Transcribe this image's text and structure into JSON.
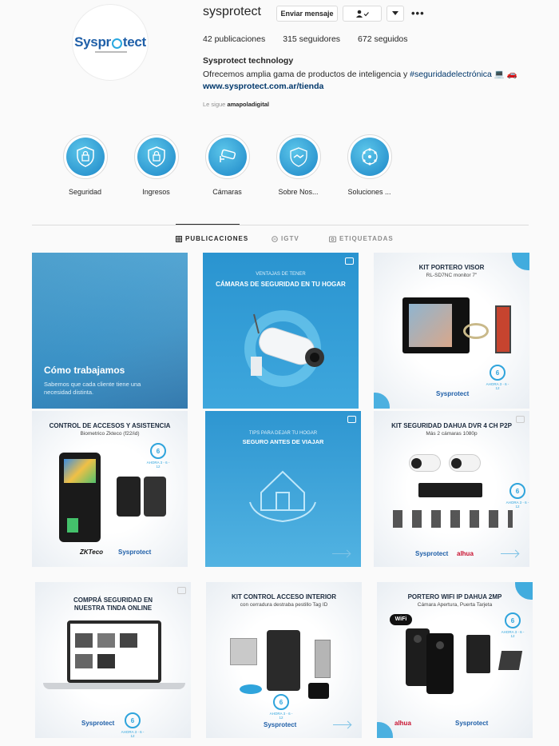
{
  "profile": {
    "username": "sysprotect",
    "avatar_logo": "Sysprotect",
    "message_button": "Enviar mensaje",
    "follow_icon": "person-check-icon",
    "dropdown_icon": "chevron-down-icon",
    "more_icon": "more-dots-icon",
    "more_label": "•••",
    "stats": {
      "posts": "42 publicaciones",
      "followers": "315 seguidores",
      "following": "672 seguidos"
    },
    "bio": {
      "name": "Sysprotect technology",
      "text": "Ofrecemos amplia gama de productos de inteligencia y ",
      "hashtag": "#seguridadelectrónica",
      "emoji": " 💻 🚗",
      "link": "www.sysprotect.com.ar/tienda"
    },
    "followed_by_prefix": "Le sigue ",
    "followed_by_user": "amapoladigital"
  },
  "highlights": [
    {
      "label": "Seguridad",
      "icon": "shield-lock-icon"
    },
    {
      "label": "Ingresos",
      "icon": "shield-lock-icon"
    },
    {
      "label": "Cámaras",
      "icon": "security-camera-icon"
    },
    {
      "label": "Sobre Nos...",
      "icon": "handshake-icon"
    },
    {
      "label": "Soluciones ...",
      "icon": "network-globe-icon"
    }
  ],
  "tabs": [
    {
      "label": "PUBLICACIONES",
      "icon": "grid-icon",
      "active": true
    },
    {
      "label": "IGTV",
      "icon": "igtv-icon",
      "active": false
    },
    {
      "label": "ETIQUETADAS",
      "icon": "tagged-icon",
      "active": false
    }
  ],
  "posts": [
    {
      "title": "Cómo trabajamos",
      "sub": "Sabemos que cada cliente tiene una necesidad distinta."
    },
    {
      "pre": "VENTAJAS DE TENER",
      "title": "CÁMARAS DE SEGURIDAD EN TU HOGAR"
    },
    {
      "title": "KIT PORTERO VISOR",
      "sub": "RL-SD7NC monitor 7\"",
      "brand": "Sysprotect",
      "ahora": "AHORA 3 - 6 - 12"
    },
    {
      "title": "CONTROL DE ACCESOS Y ASISTENCIA",
      "sub": "Biometrico Zkteco (f22/id)",
      "brand": "Sysprotect",
      "brand2": "ZKTeco",
      "ahora": "AHORA 3 - 6 - 12"
    },
    {
      "pre": "TIPS PARA DEJAR TU HOGAR",
      "title": "SEGURO ANTES DE VIAJAR"
    },
    {
      "title": "KIT SEGURIDAD DAHUA DVR 4 CH P2P",
      "sub": "Más 2 cámaras 1080p",
      "brand": "Sysprotect",
      "brand2": "alhua",
      "ahora": "AHORA 3 - 6 - 12"
    },
    {
      "title": "COMPRÁ SEGURIDAD EN NUESTRA TINDA ONLINE",
      "brand": "Sysprotect",
      "ahora": "AHORA 3 - 6 - 12"
    },
    {
      "title": "KIT CONTROL ACCESO INTERIOR",
      "sub": "con cerradura destraba pestillo Tag ID",
      "brand": "Sysprotect",
      "ahora": "AHORA 3 - 6 - 12"
    },
    {
      "title": "PORTERO WIFI IP DAHUA 2MP",
      "sub": "Cámara Apertura, Puerta Tarjeta",
      "brand": "Sysprotect",
      "brand2": "alhua",
      "badge": "WiFi",
      "ahora": "AHORA 3 - 6 - 12"
    }
  ]
}
